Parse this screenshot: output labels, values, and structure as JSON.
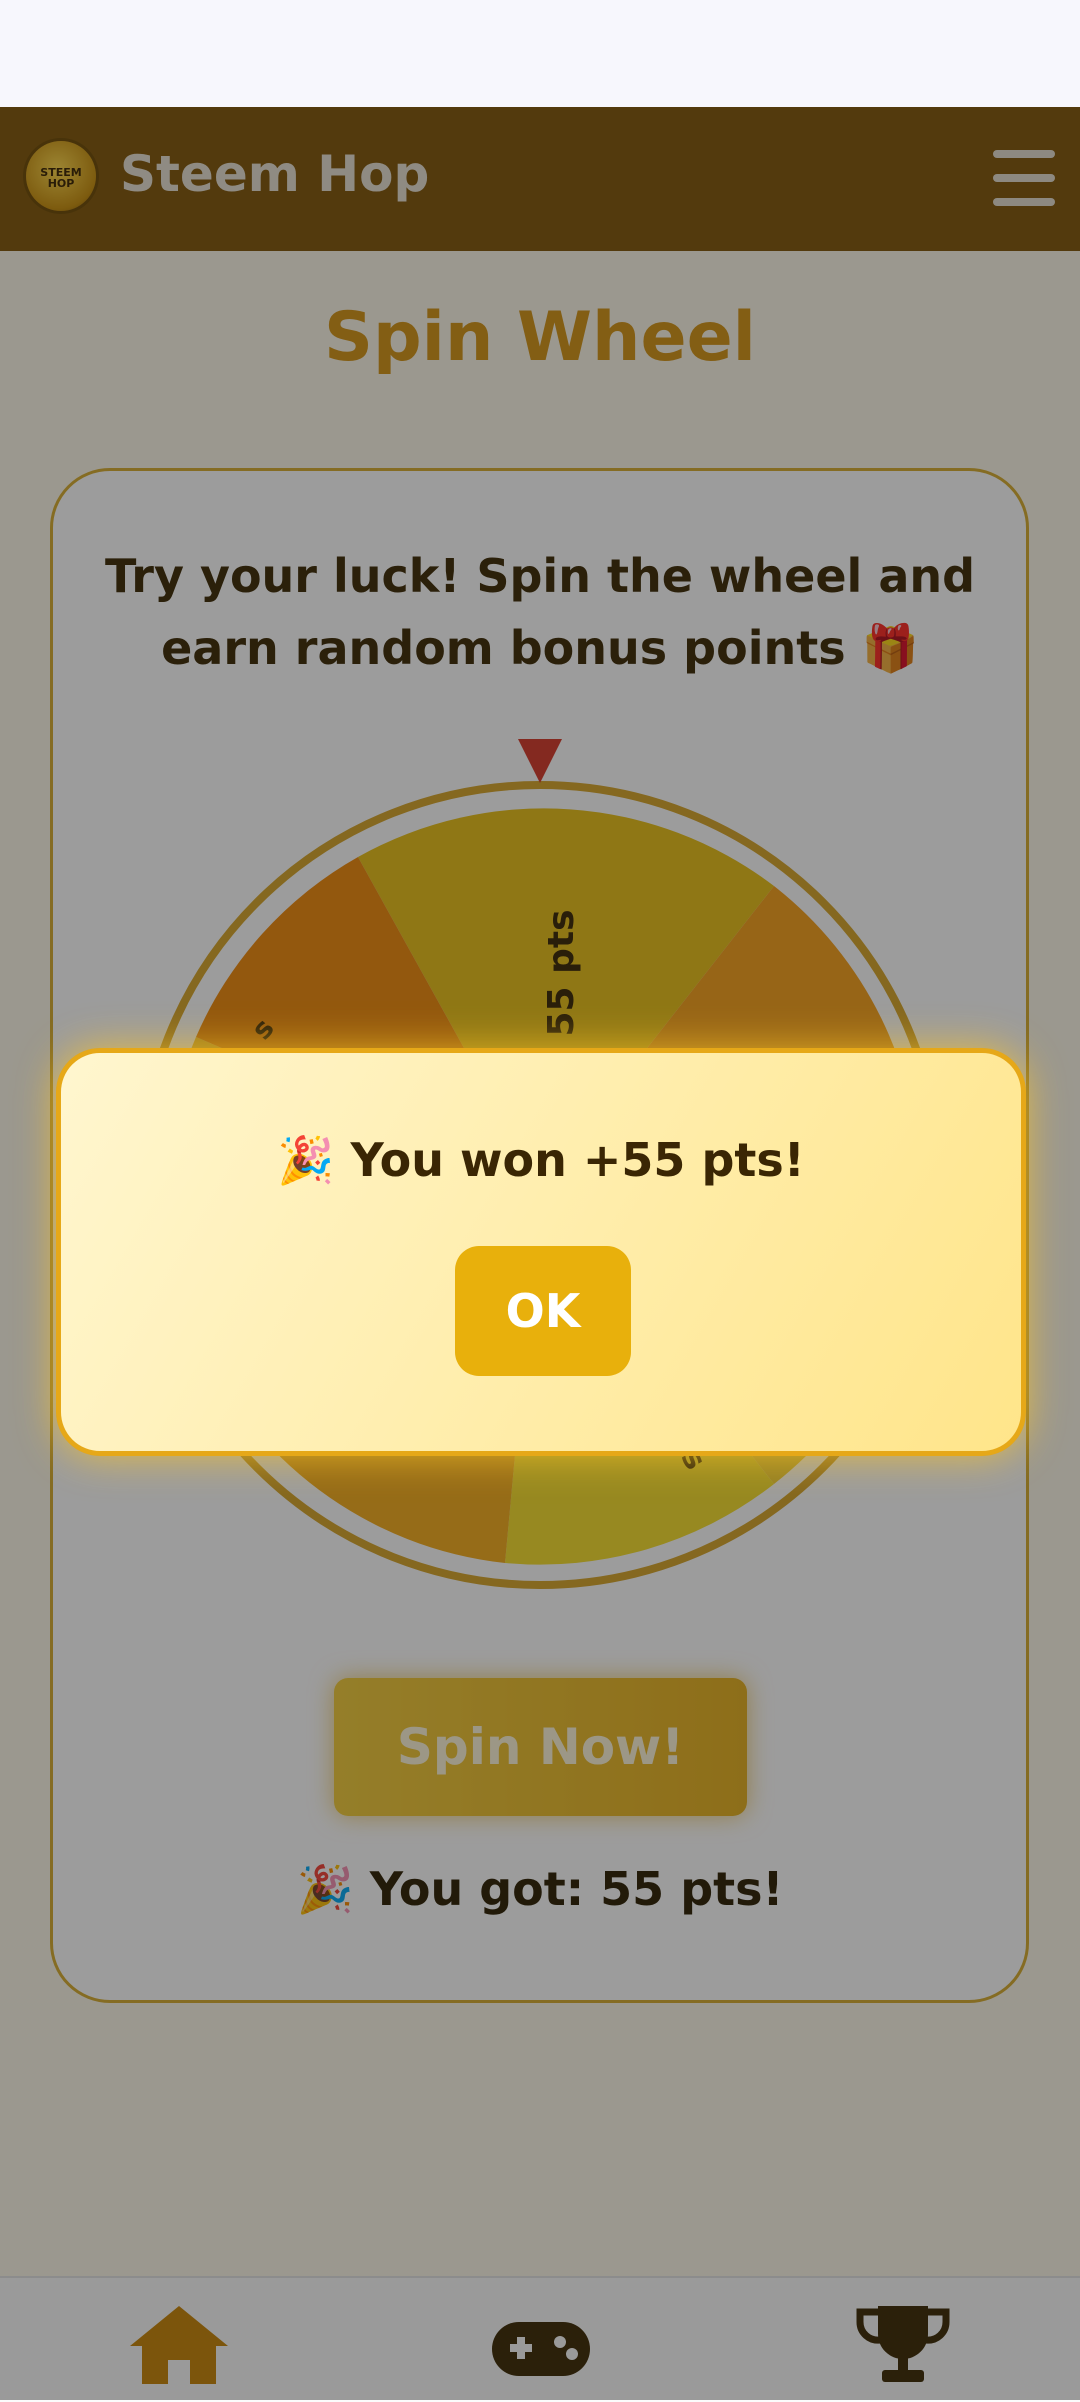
{
  "header": {
    "brand_name": "Steem Hop",
    "logo_text": "STEEM HOP"
  },
  "page": {
    "title": "Spin Wheel"
  },
  "card": {
    "intro_line1": "Try your luck! Spin the wheel and",
    "intro_line2": "earn random bonus points 🎁",
    "wheel_visible_label": "55 pts",
    "spin_button": "Spin Now!",
    "result": "🎉 You got: 55 pts!"
  },
  "modal": {
    "message": "🎉 You won +55 pts!",
    "ok_label": "OK"
  },
  "nav": {
    "items": [
      "home-icon",
      "gamepad-icon",
      "trophy-icon"
    ]
  },
  "colors": {
    "header_bg": "#82570a",
    "accent": "#d59416",
    "button": "#e8b00c",
    "modal_border": "#e6a818",
    "pointer": "#d63a2a"
  }
}
